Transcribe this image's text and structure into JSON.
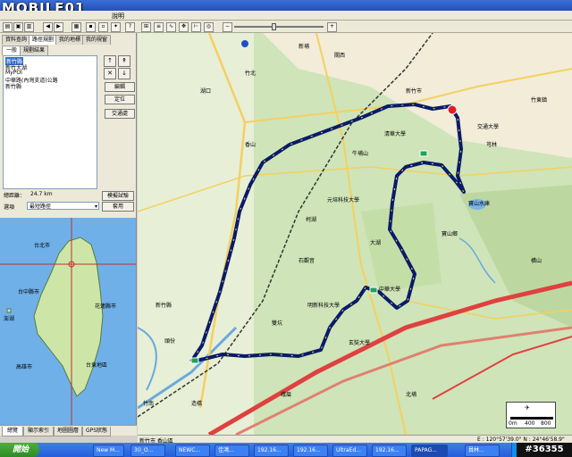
{
  "logo": "MOBILE01",
  "menubar": {
    "items": [
      "說明"
    ]
  },
  "left_panel": {
    "top_tabs": [
      "資料查詢",
      "路徑規劃",
      "我的地標",
      "我的視窗"
    ],
    "sub_tabs": [
      "一般",
      "規劃結果"
    ],
    "list_items": [
      "新竹縣",
      "新竹大湖",
      "MyPOI",
      "中華路(內灣支道)公路",
      "新竹縣"
    ],
    "buttons": {
      "edit": "編輯",
      "locate": "定位",
      "exchange": "交通處"
    },
    "distance_label": "總距離：",
    "distance_value": "24.7 km",
    "simulate_button": "模擬試驗",
    "option_label": "選項",
    "option_value": "最短路徑",
    "apply_button": "套用"
  },
  "overview": {
    "labels": [
      "台北市",
      "台中縣市",
      "花蓮縣市",
      "高雄市",
      "台東地區",
      "澎湖"
    ]
  },
  "bottom_tabs": [
    "總覽",
    "顯示索引",
    "地圖圖層",
    "GPS狀態"
  ],
  "map_labels": [
    "湖口",
    "竹北",
    "新竹市",
    "竹東鎮",
    "芎林",
    "寶山鄉",
    "峨眉",
    "北埔",
    "橫山",
    "關西",
    "香山",
    "新埔",
    "頭份",
    "竹南",
    "造橋",
    "明新科技大學",
    "中華大學",
    "交通大學",
    "清華大學",
    "玄奘大學",
    "元培科技大學",
    "寶山水庫",
    "牛埔山",
    "新竹縣",
    "石觀音",
    "雙坑",
    "柯湖",
    "大湖"
  ],
  "scale": {
    "unit": "m",
    "marks": [
      "0m",
      "400",
      "800"
    ]
  },
  "status": {
    "location": "新竹市 香山區",
    "coords": "E : 120°57'39.0\"  N : 24°46'58.9\""
  },
  "taskbar": {
    "start": "開始",
    "tasks": [
      "New M...",
      "3(I_O...",
      "NEWC...",
      "佳鴻...",
      "192.16...",
      "192.16...",
      "UltraEd...",
      "192.16...",
      "PAPAG...",
      "員林..."
    ],
    "watermark": "#36355"
  },
  "colors": {
    "route": "#0a1a6a",
    "highway": "#e04040",
    "water": "#6fb0e8"
  }
}
